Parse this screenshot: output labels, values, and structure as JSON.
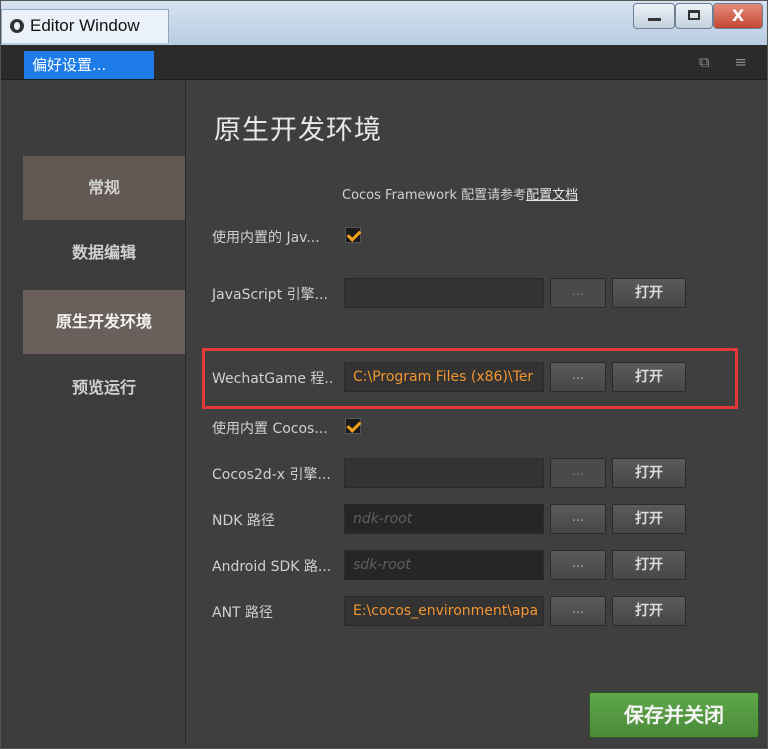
{
  "window": {
    "title": "Editor Window",
    "controls": {
      "minimize": "minimize",
      "maximize": "maximize",
      "close": "X"
    }
  },
  "tabbar": {
    "active_tab": "偏好设置...",
    "tools": "⧉ ≡"
  },
  "sidebar": {
    "items": [
      {
        "label": "常规"
      },
      {
        "label": "数据编辑"
      },
      {
        "label": "原生开发环境"
      },
      {
        "label": "预览运行"
      }
    ]
  },
  "main": {
    "title": "原生开发环境",
    "note_prefix": "Cocos Framework 配置请参考",
    "note_link": "配置文档",
    "rows": [
      {
        "label": "使用内置的 Jav...",
        "type": "checkbox",
        "checked": true
      },
      {
        "label": "JavaScript 引擎...",
        "type": "path",
        "value": "",
        "placeholder": "",
        "browse": "...",
        "open": "打开"
      },
      {
        "label": "WechatGame 程..",
        "type": "path",
        "value": "C:\\Program Files (x86)\\Ter",
        "placeholder": "",
        "browse": "...",
        "open": "打开"
      },
      {
        "label": "使用内置 Cocos...",
        "type": "checkbox",
        "checked": true
      },
      {
        "label": "Cocos2d-x 引擎...",
        "type": "path",
        "value": "",
        "placeholder": "",
        "browse": "...",
        "open": "打开"
      },
      {
        "label": "NDK 路径",
        "type": "path",
        "value": "",
        "placeholder": "ndk-root",
        "browse": "...",
        "open": "打开"
      },
      {
        "label": "Android SDK 路...",
        "type": "path",
        "value": "",
        "placeholder": "sdk-root",
        "browse": "...",
        "open": "打开"
      },
      {
        "label": "ANT 路径",
        "type": "path",
        "value": "E:\\cocos_environment\\apa",
        "placeholder": "",
        "browse": "...",
        "open": "打开"
      }
    ],
    "save_button": "保存并关闭"
  },
  "colors": {
    "accent": "#1e7ce8",
    "path_text": "#f29530",
    "highlight_box": "#e5383a",
    "save_button": "#55983f"
  }
}
